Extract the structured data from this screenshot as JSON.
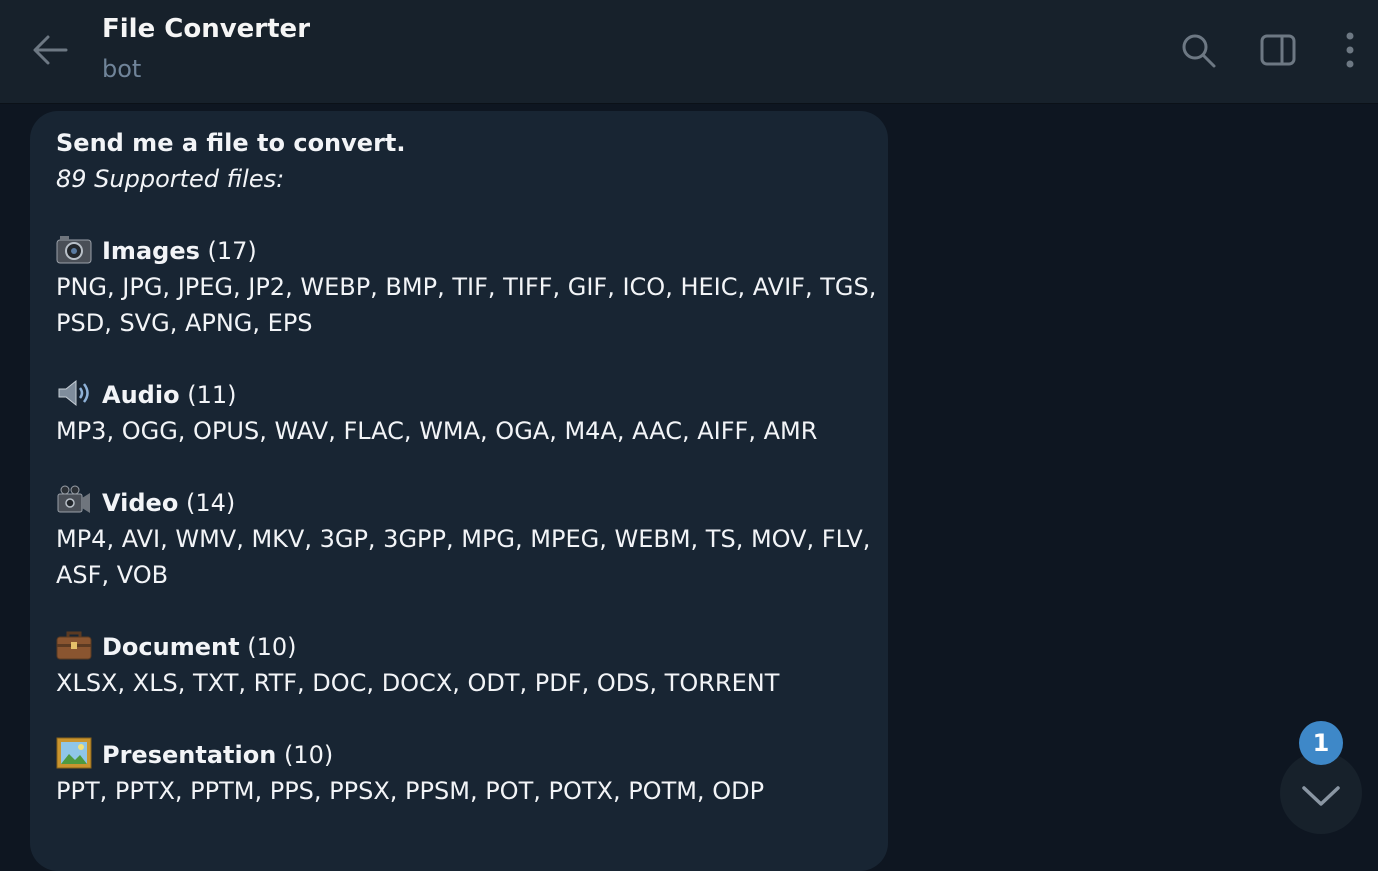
{
  "header": {
    "title": "File Converter",
    "subtitle": "bot",
    "icons": {
      "back": "arrow-left-icon",
      "search": "search-icon",
      "panel": "sidebar-toggle-icon",
      "more": "more-vertical-icon"
    }
  },
  "message": {
    "intro": "Send me a file to convert.",
    "supported": "89 Supported files:",
    "sections": [
      {
        "icon": "camera-icon",
        "title": "Images",
        "count": "(17)",
        "lines": [
          "PNG, JPG, JPEG, JP2, WEBP, BMP, TIF, TIFF, GIF, ICO, HEIC, AVIF, TGS,",
          "PSD, SVG, APNG, EPS"
        ]
      },
      {
        "icon": "speaker-icon",
        "title": "Audio",
        "count": "(11)",
        "lines": [
          "MP3, OGG, OPUS, WAV, FLAC, WMA, OGA, M4A, AAC, AIFF, AMR"
        ]
      },
      {
        "icon": "video-camera-icon",
        "title": "Video",
        "count": "(14)",
        "lines": [
          "MP4, AVI, WMV, MKV, 3GP, 3GPP, MPG, MPEG, WEBM, TS, MOV, FLV,",
          "ASF, VOB"
        ]
      },
      {
        "icon": "briefcase-icon",
        "title": "Document",
        "count": "(10)",
        "lines": [
          "XLSX, XLS, TXT, RTF, DOC, DOCX, ODT, PDF, ODS, TORRENT"
        ]
      },
      {
        "icon": "framed-picture-icon",
        "title": "Presentation",
        "count": "(10)",
        "lines": [
          "PPT, PPTX, PPTM, PPS, PPSX, PPSM, POT, POTX, POTM, ODP"
        ]
      }
    ]
  },
  "scroll_button": {
    "icon": "chevron-down-icon",
    "unread_badge": "1"
  },
  "colors": {
    "background": "#0e1621",
    "header": "#17212b",
    "bubble": "#182533",
    "accent": "#3e88c8",
    "muted": "#708499"
  }
}
